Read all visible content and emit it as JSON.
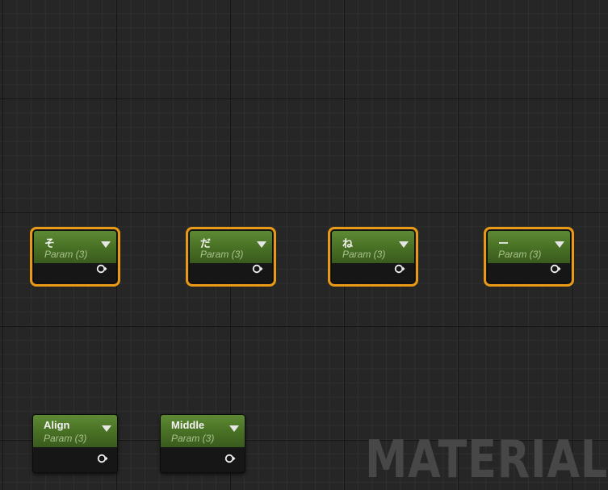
{
  "graph": {
    "watermark": "MATERIAL",
    "nodes": [
      {
        "title": "そ",
        "subtitle": "Param (3)",
        "selected": true,
        "output_icon": "output-pin-icon"
      },
      {
        "title": "だ",
        "subtitle": "Param (3)",
        "selected": true,
        "output_icon": "output-pin-icon"
      },
      {
        "title": "ね",
        "subtitle": "Param (3)",
        "selected": true,
        "output_icon": "output-pin-icon"
      },
      {
        "title": "ー",
        "subtitle": "Param (3)",
        "selected": true,
        "output_icon": "output-pin-icon"
      },
      {
        "title": "Align",
        "subtitle": "Param (3)",
        "selected": false,
        "output_icon": "output-pin-icon"
      },
      {
        "title": "Middle",
        "subtitle": "Param (3)",
        "selected": false,
        "output_icon": "output-pin-icon"
      }
    ]
  },
  "colors": {
    "background": "#262626",
    "node_header": "#4b7426",
    "selection_outline": "#e89a16",
    "node_body": "#151615"
  }
}
